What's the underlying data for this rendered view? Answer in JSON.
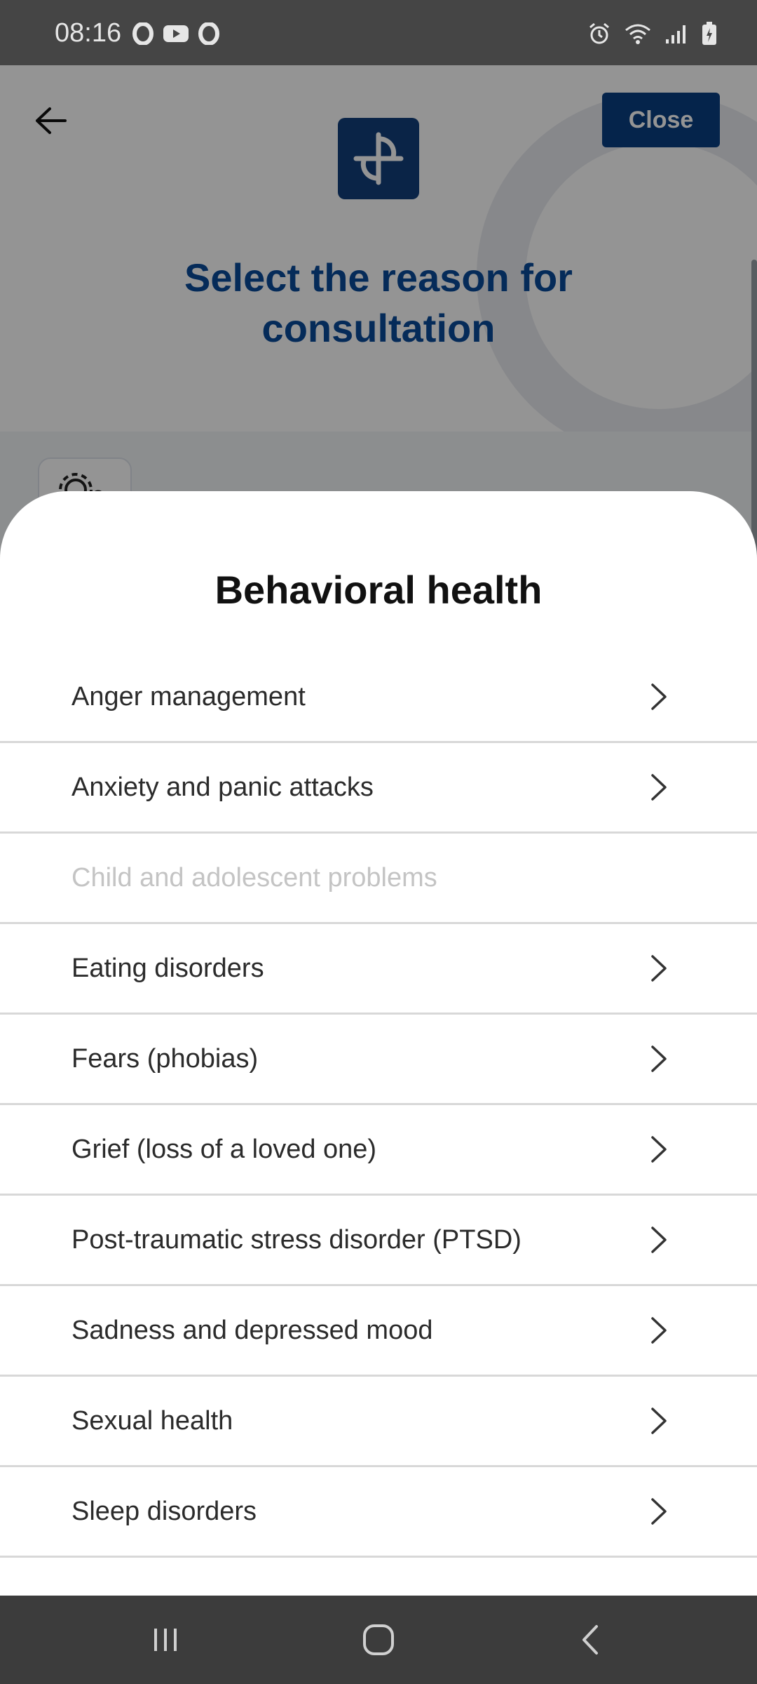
{
  "status_bar": {
    "time": "08:16",
    "left_icons": [
      "opera-icon",
      "youtube-icon",
      "opera-icon"
    ],
    "right_icons": [
      "alarm-icon",
      "wifi-icon",
      "signal-icon",
      "battery-charging-icon"
    ]
  },
  "header": {
    "close_label": "Close",
    "title": "Select the reason for consultation"
  },
  "sheet": {
    "title": "Behavioral health",
    "items": [
      {
        "label": "Anger management",
        "enabled": true
      },
      {
        "label": "Anxiety and panic attacks",
        "enabled": true
      },
      {
        "label": "Child and adolescent problems",
        "enabled": false
      },
      {
        "label": "Eating disorders",
        "enabled": true
      },
      {
        "label": "Fears (phobias)",
        "enabled": true
      },
      {
        "label": "Grief (loss of a loved one)",
        "enabled": true
      },
      {
        "label": "Post-traumatic stress disorder (PTSD)",
        "enabled": true
      },
      {
        "label": "Sadness and depressed mood",
        "enabled": true
      },
      {
        "label": "Sexual health",
        "enabled": true
      },
      {
        "label": "Sleep disorders",
        "enabled": true
      }
    ]
  },
  "colors": {
    "brand_blue": "#0a3f82",
    "title_blue": "#0a4a9a",
    "disabled_text": "#c4c4c4"
  }
}
